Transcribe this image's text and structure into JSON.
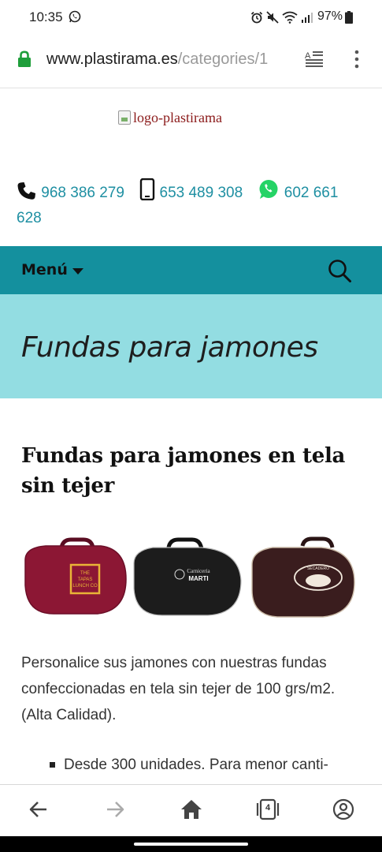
{
  "status_bar": {
    "time": "10:35",
    "battery": "97%",
    "icons": [
      "whatsapp-icon",
      "alarm-icon",
      "mute-icon",
      "wifi-icon",
      "signal-icon",
      "battery-icon"
    ]
  },
  "browser": {
    "url_domain": "www.plastirama.es",
    "url_path": "/categories/1",
    "icons": [
      "lock-icon",
      "reader-mode-icon",
      "more-vert-icon"
    ]
  },
  "header": {
    "logo_alt": "logo-plastirama",
    "phone": "968 386 279",
    "mobile": "653 489 308",
    "whatsapp": "602 661 628"
  },
  "nav": {
    "menu_label": "Menú"
  },
  "hero": {
    "title": "Fundas para jamones"
  },
  "content": {
    "heading": "Fundas para jamones en tela sin tejer",
    "bags": [
      {
        "color": "#8c1734",
        "print": "THE TAPAS LUNCH CO"
      },
      {
        "color": "#1c1c1c",
        "print": "Carniceria MARTI"
      },
      {
        "color": "#3a1d1e",
        "print": "SECADERO"
      }
    ],
    "intro": "Personalice sus jamones con nuestras fundas confeccionadas en tela sin tejer de 100 grs/m2. (Alta Calidad).",
    "bullets": [
      "Desde 300 unidades. Para menor canti-"
    ]
  },
  "colors": {
    "teal": "#14909e",
    "light_teal": "#93dde2",
    "link": "#1e8fa2",
    "whatsapp_green": "#25d366",
    "lock_green": "#1e9e3a"
  },
  "bottom_nav": {
    "tab_count": "4",
    "icons": [
      "back-arrow-icon",
      "forward-arrow-icon",
      "home-icon",
      "tabs-icon",
      "account-icon"
    ]
  }
}
